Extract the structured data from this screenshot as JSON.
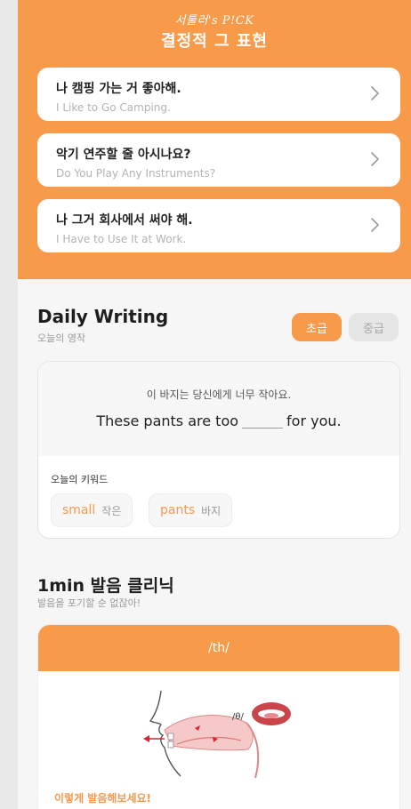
{
  "pick": {
    "brand": "서툴러's P!CK",
    "title": "결정적 그 표현",
    "phrases": [
      {
        "ko": "나 캠핑 가는 거 좋아해.",
        "en": "I Like to Go Camping."
      },
      {
        "ko": "악기 연주할 줄 아시나요?",
        "en": "Do You Play Any Instruments?"
      },
      {
        "ko": "나 그거 회사에서 써야 해.",
        "en": "I Have to Use It at Work."
      }
    ],
    "chevron_icon": "chevron-right-icon"
  },
  "daily_writing": {
    "title": "Daily Writing",
    "subtitle": "오늘의 영작",
    "levels": {
      "beginner": "초급",
      "intermediate": "중급"
    },
    "korean_sentence": "이 바지는 당신에게 너무 작아요.",
    "english_before_blank": "These pants are too",
    "english_after_blank": "for you.",
    "keyword_label": "오늘의 키워드",
    "keywords": [
      {
        "word": "small",
        "meaning": "작은"
      },
      {
        "word": "pants",
        "meaning": "바지"
      }
    ]
  },
  "pronunciation": {
    "title": "1min 발음 클리닉",
    "subtitle": "발음을 포기할 순 없잖아!",
    "sound": "/th/",
    "diagram_label": "/θ/",
    "hint": "이렇게 발음해보세요!"
  },
  "colors": {
    "accent": "#f79a4a",
    "accent_text": "#f59a50",
    "background": "#f6f6f6"
  }
}
